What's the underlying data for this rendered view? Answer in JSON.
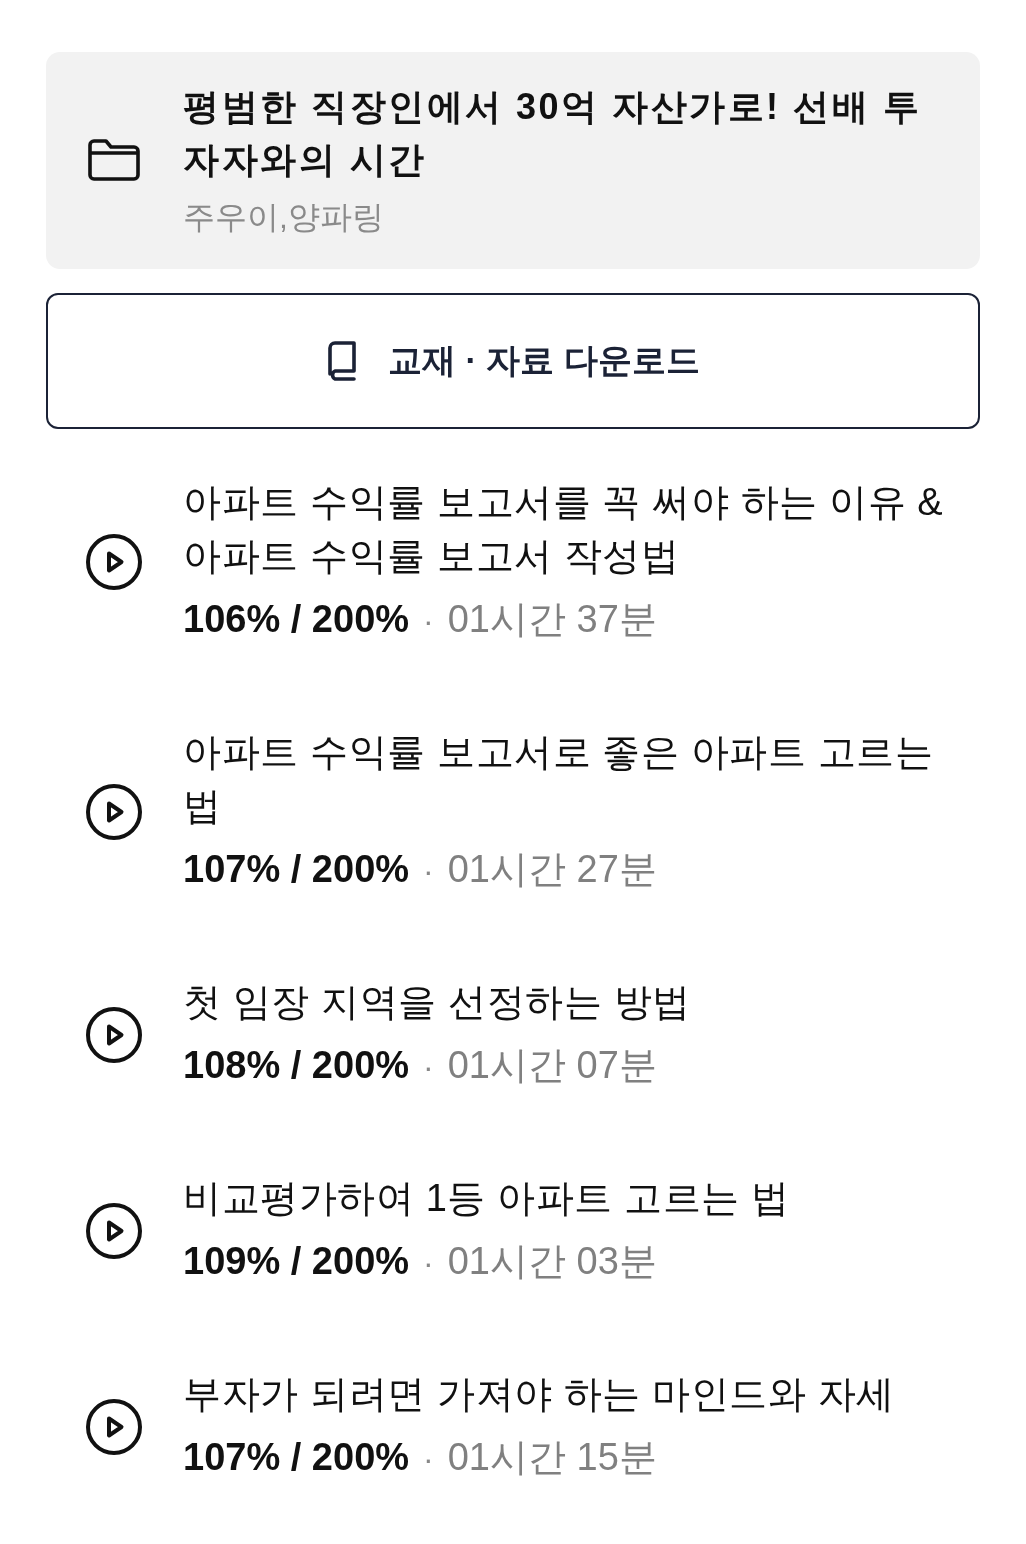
{
  "course": {
    "title": "평범한 직장인에서 30억 자산가로! 선배 투자자와의 시간",
    "authors": "주우이,양파링"
  },
  "download_button": {
    "label": "교재 · 자료 다운로드"
  },
  "lessons": [
    {
      "title": "아파트 수익률 보고서를 꼭 써야 하는 이유 & 아파트 수익률 보고서 작성법",
      "progress": "106% / 200%",
      "separator": "·",
      "duration": "01시간 37분"
    },
    {
      "title": "아파트 수익률 보고서로 좋은 아파트 고르는 법",
      "progress": "107% / 200%",
      "separator": "·",
      "duration": "01시간 27분"
    },
    {
      "title": "첫 임장 지역을 선정하는 방법",
      "progress": "108% / 200%",
      "separator": "·",
      "duration": "01시간 07분"
    },
    {
      "title": "비교평가하여 1등 아파트 고르는 법",
      "progress": "109% / 200%",
      "separator": "·",
      "duration": "01시간 03분"
    },
    {
      "title": "부자가 되려면 가져야 하는 마인드와 자세",
      "progress": "107% / 200%",
      "separator": "·",
      "duration": "01시간 15분"
    }
  ]
}
